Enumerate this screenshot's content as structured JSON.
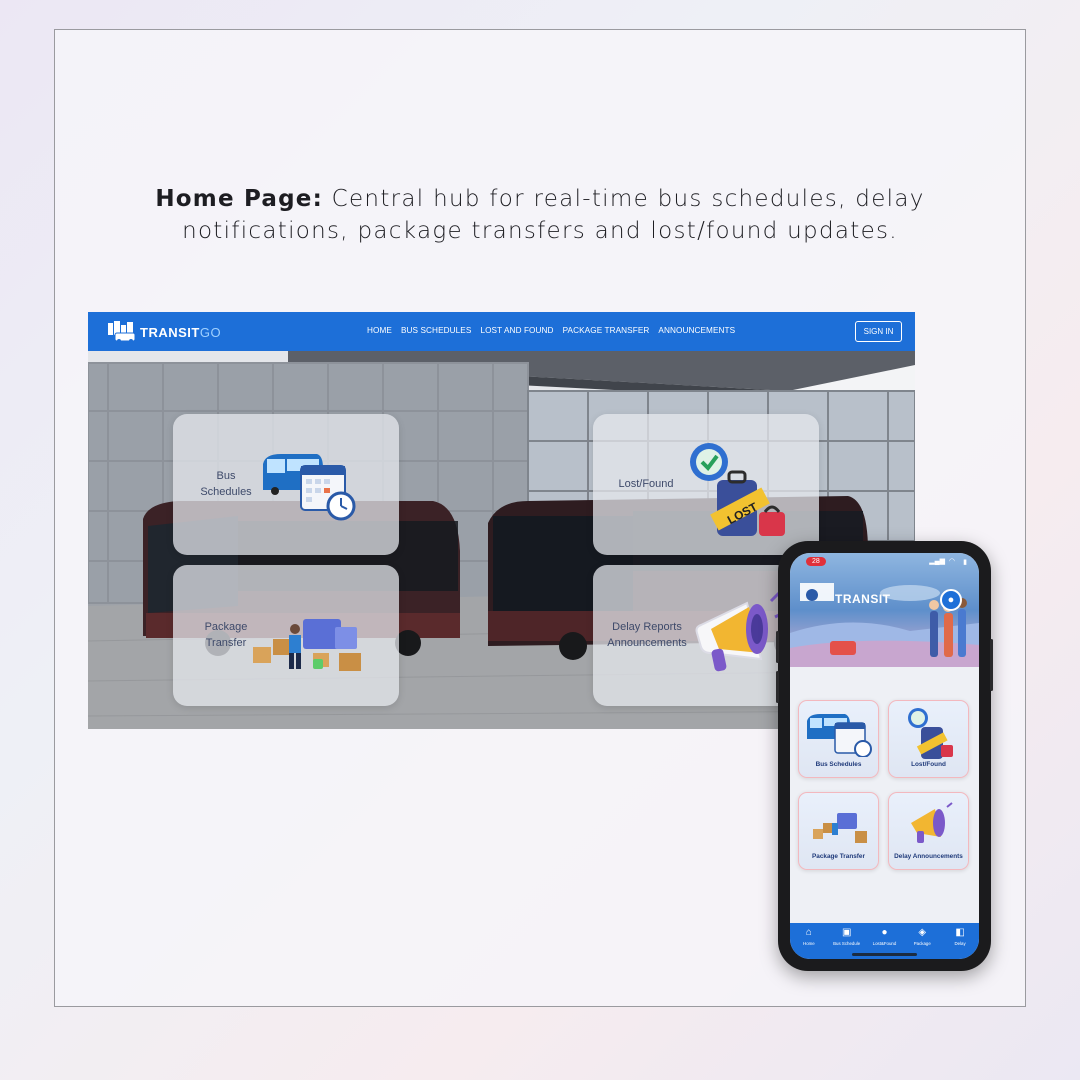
{
  "caption": {
    "bold": "Home Page:",
    "line1": " Central hub for real-time bus schedules, delay",
    "line2": "notifications, package transfers and lost/found updates."
  },
  "desktop": {
    "logo": {
      "main": "TRANSIT",
      "accent": "GO"
    },
    "nav": [
      "HOME",
      "BUS SCHEDULES",
      "LOST AND FOUND",
      "PACKAGE TRANSFER",
      "ANNOUNCEMENTS"
    ],
    "signin_label": "SIGN IN",
    "cards": [
      {
        "line1": "Bus",
        "line2": "Schedules",
        "icon": "bus-calendar-icon"
      },
      {
        "line1": "Lost/Found",
        "line2": "",
        "icon": "lost-luggage-icon"
      },
      {
        "line1": "Package",
        "line2": "Transfer",
        "icon": "package-delivery-icon"
      },
      {
        "line1": "Delay Reports",
        "line2": "Announcements",
        "icon": "megaphone-icon"
      }
    ]
  },
  "phone": {
    "time": "28",
    "title": "TRANSIT",
    "cards": [
      {
        "label": "Bus Schedules",
        "icon": "bus-calendar-icon"
      },
      {
        "label": "Lost/Found",
        "icon": "lost-luggage-icon"
      },
      {
        "label": "Package Transfer",
        "icon": "package-delivery-icon"
      },
      {
        "label": "Delay Announcements",
        "icon": "megaphone-icon"
      }
    ],
    "tabs": [
      {
        "label": "Home",
        "icon": "home-icon"
      },
      {
        "label": "Bus Schedule",
        "icon": "bus-icon"
      },
      {
        "label": "Lost&Found",
        "icon": "alert-icon"
      },
      {
        "label": "Package",
        "icon": "box-icon"
      },
      {
        "label": "Delay",
        "icon": "megaphone-icon"
      }
    ]
  },
  "colors": {
    "brand_blue": "#1d6fd8",
    "accent_red": "#e0303a"
  }
}
